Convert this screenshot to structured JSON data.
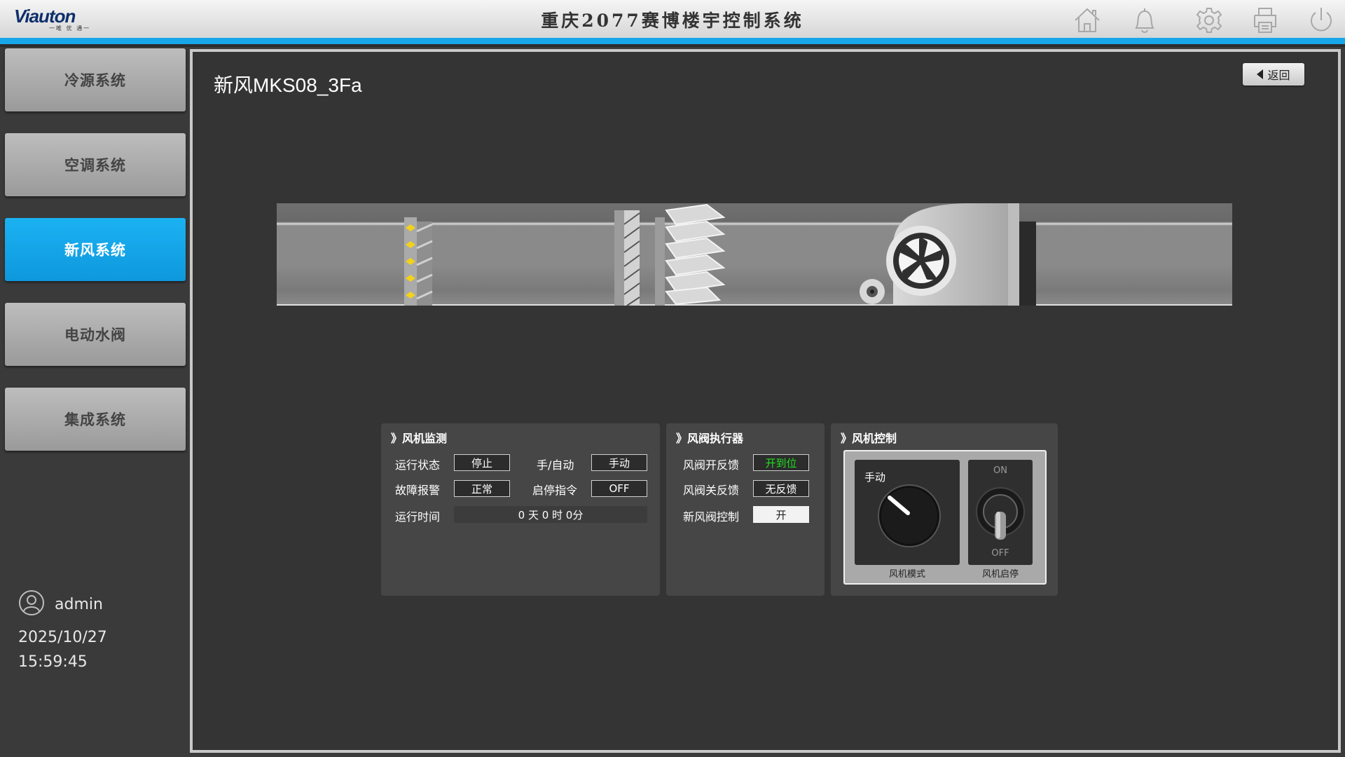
{
  "header": {
    "logo_text": "Viauton",
    "logo_sub": "一唯 优 通一",
    "title": "重庆2077赛博楼宇控制系统",
    "icons": [
      "home-icon",
      "bell-icon",
      "gear-icon",
      "printer-icon",
      "power-icon"
    ]
  },
  "sidebar": {
    "items": [
      {
        "label": "冷源系统",
        "active": false
      },
      {
        "label": "空调系统",
        "active": false
      },
      {
        "label": "新风系统",
        "active": true
      },
      {
        "label": "电动水阀",
        "active": false
      },
      {
        "label": "集成系统",
        "active": false
      }
    ],
    "user": "admin",
    "date": "2025/10/27",
    "time": "15:59:45"
  },
  "main": {
    "title": "新风MKS08_3Fa",
    "back_label": "返回"
  },
  "fan_monitor": {
    "title": "》风机监测",
    "run_status_label": "运行状态",
    "run_status": "停止",
    "mode_label": "手/自动",
    "mode": "手动",
    "fault_label": "故障报警",
    "fault": "正常",
    "cmd_label": "启停指令",
    "cmd": "OFF",
    "runtime_label": "运行时间",
    "runtime": "0 天 0 时 0分"
  },
  "damper": {
    "title": "》风阀执行器",
    "open_fb_label": "风阀开反馈",
    "open_fb": "开到位",
    "close_fb_label": "风阀关反馈",
    "close_fb": "无反馈",
    "control_label": "新风阀控制",
    "control": "开"
  },
  "fan_control": {
    "title": "》风机控制",
    "mode_knob_value": "手动",
    "mode_caption": "风机模式",
    "switch_on": "ON",
    "switch_off": "OFF",
    "switch_caption": "风机启停"
  },
  "colors": {
    "accent": "#17a6e8",
    "active_nav": "#12a4e8",
    "feedback_green": "#1ee01e"
  }
}
